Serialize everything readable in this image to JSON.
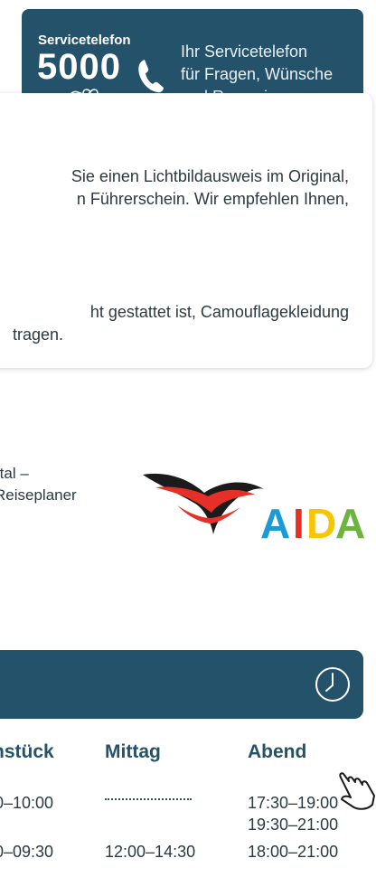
{
  "service": {
    "label": "Servicetelefon",
    "number": "5000",
    "lines": [
      "Ihr Servicetelefon",
      "für Fragen, Wünsche",
      "und Reservierungen"
    ]
  },
  "info": {
    "line1": "Sie einen Lichtbildausweis im Original,",
    "line2": "n Führerschein. Wir empfehlen Ihnen,",
    "line3": "ht gestattet ist, Camouflagekleidung",
    "line4": "tragen."
  },
  "partner": {
    "line1": "rtal –",
    "line2": "Reiseplaner",
    "line3": ".",
    "logo_text": "AIDA"
  },
  "hours": {
    "columns": [
      "nstück",
      "Mittag",
      "Abend"
    ],
    "rows": [
      [
        "0–10:00",
        "",
        "17:30–19:00"
      ],
      [
        "",
        "",
        "19:30–21:00"
      ],
      [
        "0–09:30",
        "12:00–14:30",
        "18:00–21:00"
      ]
    ]
  },
  "colors": {
    "primary": "#24526a",
    "aida_red": "#e63027",
    "aida_blue": "#1a9bd7",
    "aida_yellow": "#f7c600",
    "aida_green": "#6cb33f"
  }
}
